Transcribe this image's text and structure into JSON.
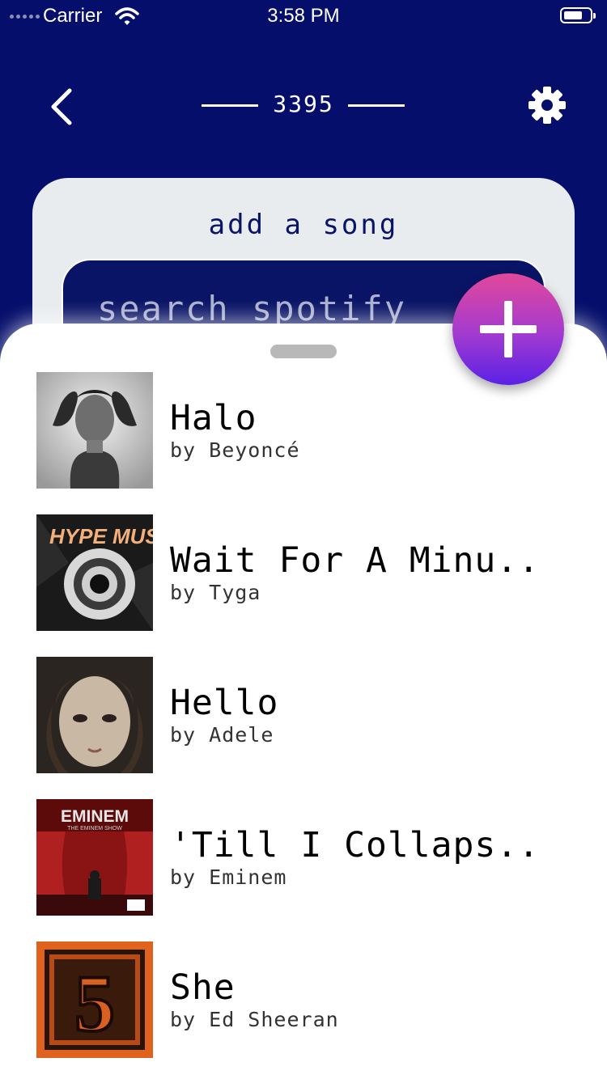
{
  "status_bar": {
    "carrier": "Carrier",
    "time": "3:58 PM"
  },
  "header": {
    "room_code": "3395",
    "back_icon": "chevron-left-icon",
    "settings_icon": "gear-icon"
  },
  "add_song": {
    "title": "add a song",
    "search_placeholder": "search spotify"
  },
  "fab": {
    "icon": "plus-icon"
  },
  "colors": {
    "background": "#050f6b",
    "card": "#e9ecef",
    "search_field": "#0a1466",
    "fab_top": "#e2489a",
    "fab_bottom": "#5a21e6"
  },
  "songs": [
    {
      "title": "Halo",
      "artist": "by Beyoncé"
    },
    {
      "title": "Wait For A Minu..",
      "artist": "by Tyga"
    },
    {
      "title": "Hello",
      "artist": "by Adele"
    },
    {
      "title": "'Till I Collaps..",
      "artist": "by Eminem"
    },
    {
      "title": "She",
      "artist": "by Ed Sheeran"
    }
  ],
  "album_art_text": {
    "hype_music": "HYPE MUSIC",
    "eminem": "EMINEM",
    "eminem_sub": "THE EMINEM SHOW",
    "ed_sheeran": "5"
  }
}
